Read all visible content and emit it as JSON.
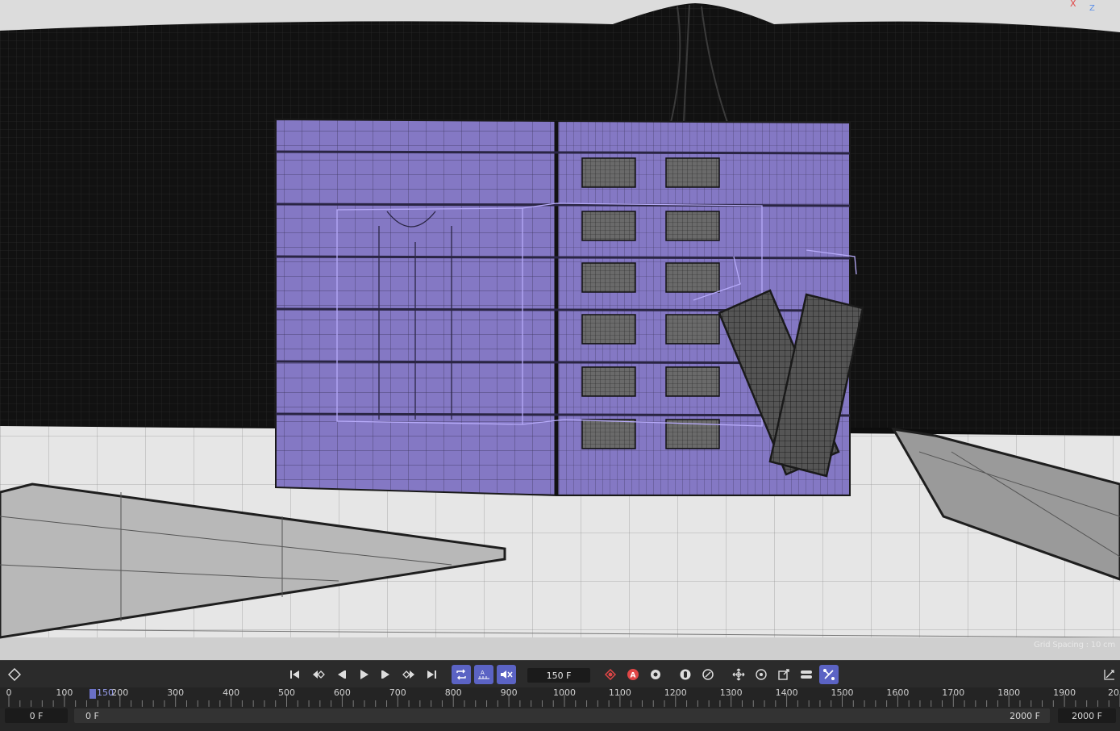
{
  "viewport": {
    "grid_spacing": "Grid Spacing : 10 cm",
    "axis_x": "X",
    "axis_z": "Z"
  },
  "toolbar": {
    "keyframe_icon": "diamond-keyframe-icon",
    "current_frame": "150 F",
    "colors": {
      "active": "#5b63c4",
      "record": "#e04646"
    }
  },
  "timeline": {
    "ticks": [
      "0",
      "100",
      "150",
      "200",
      "300",
      "400",
      "500",
      "600",
      "700",
      "800",
      "900",
      "1000",
      "1100",
      "1200",
      "1300",
      "1400",
      "1500",
      "1600",
      "1700",
      "1800",
      "1900",
      "20"
    ],
    "playhead_label": "150"
  },
  "range": {
    "start_left": "0 F",
    "start_right": "0 F",
    "end_left": "2000 F",
    "end_right": "2000 F"
  }
}
